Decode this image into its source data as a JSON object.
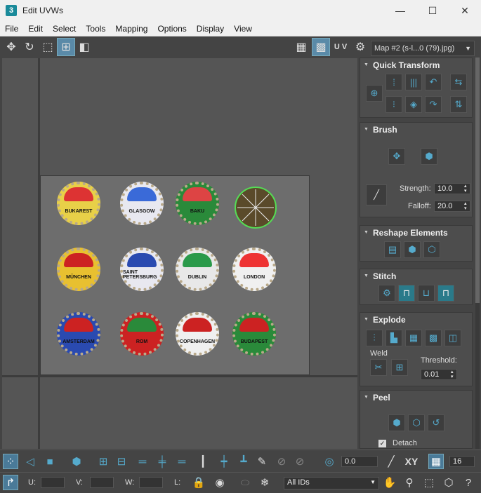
{
  "window": {
    "title": "Edit UVWs",
    "app_icon": "3",
    "minimize": "—",
    "maximize": "☐",
    "close": "✕"
  },
  "menu": [
    "File",
    "Edit",
    "Select",
    "Tools",
    "Mapping",
    "Options",
    "Display",
    "View"
  ],
  "toolbar": {
    "uv_label": "U V",
    "map_select": "Map #2 (s-l...0 (79).jpg)"
  },
  "texture_caps": [
    {
      "label": "BUKAREST",
      "top": "#d33",
      "bottom": "#e8d048"
    },
    {
      "label": "GLASGOW",
      "top": "#3a6ad8",
      "bottom": "#e8e8f0"
    },
    {
      "label": "BAKU",
      "top": "#d44",
      "bottom": "#2a8a3a"
    },
    {
      "label": "",
      "top": "#5a4a2a",
      "bottom": "#5a4a2a"
    },
    {
      "label": "MÜNCHEN",
      "top": "#c22",
      "bottom": "#e8c030"
    },
    {
      "label": "SAINT PETERSBURG",
      "top": "#2a4ab0",
      "bottom": "#e8e8f0"
    },
    {
      "label": "DUBLIN",
      "top": "#2a9a4a",
      "bottom": "#e8e8e8"
    },
    {
      "label": "LONDON",
      "top": "#e33",
      "bottom": "#f0f0f0"
    },
    {
      "label": "AMSTERDAM",
      "top": "#c22",
      "bottom": "#2a4ab0"
    },
    {
      "label": "ROM",
      "top": "#2a8a3a",
      "bottom": "#c22"
    },
    {
      "label": "COPENHAGEN",
      "top": "#c22",
      "bottom": "#f0f0f0"
    },
    {
      "label": "BUDAPEST",
      "top": "#c22",
      "bottom": "#2a8a3a"
    }
  ],
  "panel": {
    "quick_transform": "Quick Transform",
    "brush": "Brush",
    "strength_label": "Strength:",
    "strength": "10.0",
    "falloff_label": "Falloff:",
    "falloff": "20.0",
    "reshape": "Reshape Elements",
    "stitch": "Stitch",
    "explode": "Explode",
    "weld": "Weld",
    "threshold_label": "Threshold:",
    "threshold": "0.01",
    "peel": "Peel",
    "detach": "Detach"
  },
  "bottom": {
    "angle": "0.0",
    "xy": "XY",
    "pixels": "16",
    "u_label": "U:",
    "v_label": "V:",
    "w_label": "W:",
    "l_label": "L:",
    "ids": "All IDs"
  },
  "colors": {
    "accent": "#5ac",
    "selection": "#5d5"
  }
}
